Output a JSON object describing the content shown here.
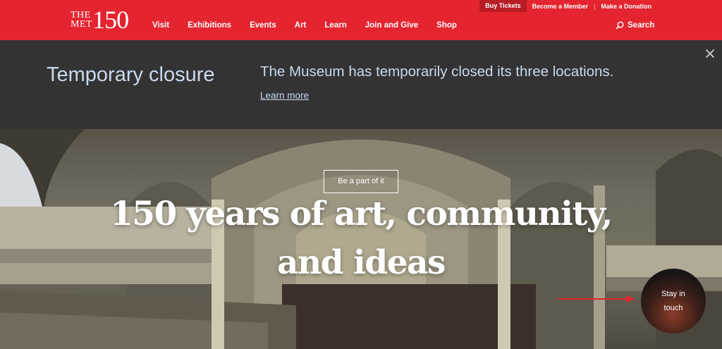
{
  "utility_nav": {
    "buy_tickets": "Buy Tickets",
    "become_member": "Become a Member",
    "separator": "|",
    "donation": "Make a Donation"
  },
  "logo": {
    "line1": "THE",
    "line2": "MET",
    "number": "150"
  },
  "nav": {
    "items": [
      "Visit",
      "Exhibitions",
      "Events",
      "Art",
      "Learn",
      "Join and Give",
      "Shop"
    ],
    "search_label": "Search"
  },
  "banner": {
    "title": "Temporary closure",
    "message": "The Museum has temporarily closed its three locations.",
    "link": "Learn more"
  },
  "hero": {
    "headline_line1": "150 years of art, community,",
    "headline_line2": "and ideas",
    "cta": "Be a part of it",
    "stay_line1": "Stay in",
    "stay_line2": "touch"
  },
  "colors": {
    "brand_red": "#e4242f",
    "banner_bg": "#333333",
    "banner_text": "#c9d9ec",
    "arrow_red": "#e4242f"
  },
  "icons": [
    "search-icon",
    "close-icon",
    "arrow-annotation"
  ]
}
